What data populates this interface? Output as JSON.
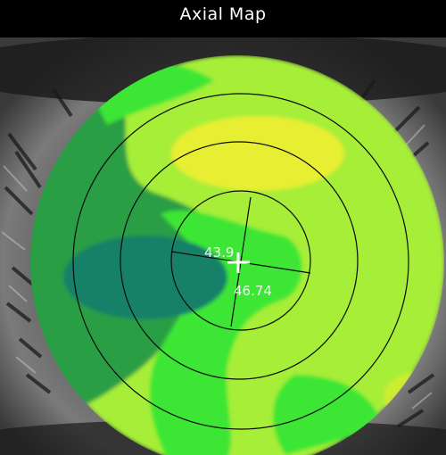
{
  "window": {
    "title": "Axial Map"
  },
  "map": {
    "readouts": {
      "flat_k": "43.9",
      "steep_k": "46.74"
    },
    "palette": {
      "dark_teal": "#148068",
      "medium_green": "#2a9e44",
      "bright_green": "#3ce634",
      "lime": "#a6ee38",
      "yellow": "#e8ee30",
      "ring_line": "#0a0a0a",
      "cursor": "#ffffff"
    },
    "icons": {
      "center": "crosshair-icon"
    }
  }
}
